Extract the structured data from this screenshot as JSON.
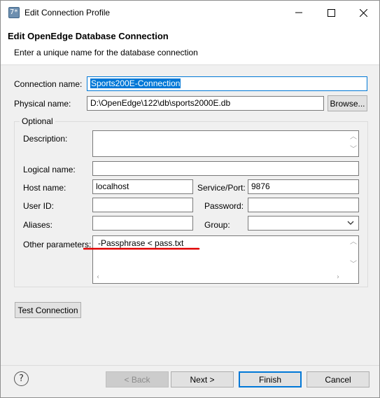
{
  "window": {
    "title": "Edit Connection Profile",
    "header_title": "Edit OpenEdge Database Connection",
    "header_subtitle": "Enter a unique name for the database connection"
  },
  "connection_name": {
    "label": "Connection name:",
    "value": "Sports200E-Connection"
  },
  "physical_name": {
    "label": "Physical name:",
    "value": "D:\\OpenEdge\\122\\db\\sports2000E.db",
    "browse_label": "Browse..."
  },
  "optional": {
    "legend": "Optional",
    "description": {
      "label": "Description:",
      "value": ""
    },
    "logical_name": {
      "label": "Logical name:",
      "value": ""
    },
    "host_name": {
      "label": "Host name:",
      "value": "localhost"
    },
    "service_port": {
      "label": "Service/Port:",
      "value": "9876"
    },
    "user_id": {
      "label": "User ID:",
      "value": ""
    },
    "password": {
      "label": "Password:",
      "value": ""
    },
    "aliases": {
      "label": "Aliases:",
      "value": ""
    },
    "group": {
      "label": "Group:",
      "value": ""
    },
    "other_parameters": {
      "label": "Other parameters:",
      "value": "-Passphrase < pass.txt"
    }
  },
  "test_connection_label": "Test Connection",
  "footer": {
    "help_icon": "?",
    "back_label": "< Back",
    "next_label": "Next >",
    "finish_label": "Finish",
    "cancel_label": "Cancel"
  },
  "colors": {
    "accent": "#0078d7",
    "annotation": "#e00000"
  }
}
